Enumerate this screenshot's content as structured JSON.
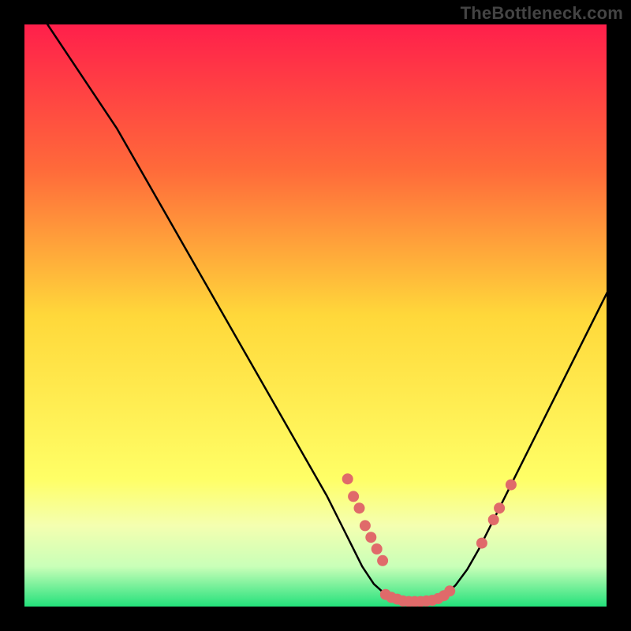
{
  "watermark": "TheBottleneck.com",
  "chart_data": {
    "type": "line",
    "title": "",
    "xlabel": "",
    "ylabel": "",
    "xlim": [
      0,
      100
    ],
    "ylim": [
      0,
      100
    ],
    "background_gradient": {
      "stops": [
        {
          "offset": 0.0,
          "color": "#ff1f4b"
        },
        {
          "offset": 0.25,
          "color": "#ff6a3a"
        },
        {
          "offset": 0.5,
          "color": "#ffd83a"
        },
        {
          "offset": 0.78,
          "color": "#ffff66"
        },
        {
          "offset": 0.86,
          "color": "#f4ffb0"
        },
        {
          "offset": 0.93,
          "color": "#c9ffb8"
        },
        {
          "offset": 1.0,
          "color": "#20e07a"
        }
      ]
    },
    "curve": [
      {
        "x": 4,
        "y": 100
      },
      {
        "x": 8,
        "y": 94
      },
      {
        "x": 12,
        "y": 88
      },
      {
        "x": 16,
        "y": 82
      },
      {
        "x": 20,
        "y": 75
      },
      {
        "x": 24,
        "y": 68
      },
      {
        "x": 28,
        "y": 61
      },
      {
        "x": 32,
        "y": 54
      },
      {
        "x": 36,
        "y": 47
      },
      {
        "x": 40,
        "y": 40
      },
      {
        "x": 44,
        "y": 33
      },
      {
        "x": 48,
        "y": 26
      },
      {
        "x": 52,
        "y": 19
      },
      {
        "x": 54,
        "y": 15
      },
      {
        "x": 56,
        "y": 11
      },
      {
        "x": 58,
        "y": 7
      },
      {
        "x": 60,
        "y": 4
      },
      {
        "x": 62,
        "y": 2.2
      },
      {
        "x": 64,
        "y": 1.4
      },
      {
        "x": 66,
        "y": 1.0
      },
      {
        "x": 68,
        "y": 1.0
      },
      {
        "x": 70,
        "y": 1.2
      },
      {
        "x": 72,
        "y": 2.0
      },
      {
        "x": 74,
        "y": 3.8
      },
      {
        "x": 76,
        "y": 6.5
      },
      {
        "x": 78,
        "y": 10
      },
      {
        "x": 80,
        "y": 14
      },
      {
        "x": 84,
        "y": 22
      },
      {
        "x": 88,
        "y": 30
      },
      {
        "x": 92,
        "y": 38
      },
      {
        "x": 96,
        "y": 46
      },
      {
        "x": 100,
        "y": 54
      }
    ],
    "markers": [
      {
        "x": 55.5,
        "y": 22
      },
      {
        "x": 56.5,
        "y": 19
      },
      {
        "x": 57.5,
        "y": 17
      },
      {
        "x": 58.5,
        "y": 14
      },
      {
        "x": 59.5,
        "y": 12
      },
      {
        "x": 60.5,
        "y": 10
      },
      {
        "x": 61.5,
        "y": 8
      },
      {
        "x": 62.0,
        "y": 2.2
      },
      {
        "x": 63.0,
        "y": 1.7
      },
      {
        "x": 64.0,
        "y": 1.4
      },
      {
        "x": 65.0,
        "y": 1.1
      },
      {
        "x": 66.0,
        "y": 1.0
      },
      {
        "x": 67.0,
        "y": 1.0
      },
      {
        "x": 68.0,
        "y": 1.0
      },
      {
        "x": 69.0,
        "y": 1.1
      },
      {
        "x": 70.0,
        "y": 1.2
      },
      {
        "x": 71.0,
        "y": 1.5
      },
      {
        "x": 72.0,
        "y": 2.0
      },
      {
        "x": 73.0,
        "y": 2.8
      },
      {
        "x": 78.5,
        "y": 11
      },
      {
        "x": 80.5,
        "y": 15
      },
      {
        "x": 81.5,
        "y": 17
      },
      {
        "x": 83.5,
        "y": 21
      }
    ],
    "marker_style": {
      "color": "#e06a6a",
      "radius": 7
    },
    "curve_style": {
      "color": "#000000",
      "width": 2.5
    },
    "frame_stroke": "#000000"
  }
}
